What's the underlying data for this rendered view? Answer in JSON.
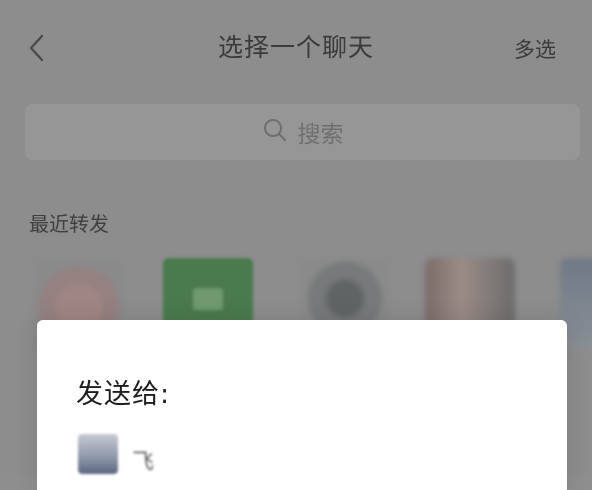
{
  "header": {
    "title": "选择一个聊天",
    "multi_select_label": "多选"
  },
  "search": {
    "placeholder": "搜索"
  },
  "recent": {
    "section_label": "最近转发",
    "avatars": [
      "avatar-1",
      "avatar-2",
      "avatar-3",
      "avatar-4",
      "avatar-5"
    ]
  },
  "dialog": {
    "title": "发送给:",
    "recipient_name": "飞"
  },
  "icons": {
    "back": "chevron-left-icon",
    "search": "search-icon"
  },
  "colors": {
    "overlay": "#8d8d8d",
    "dialog_bg": "#ffffff"
  }
}
